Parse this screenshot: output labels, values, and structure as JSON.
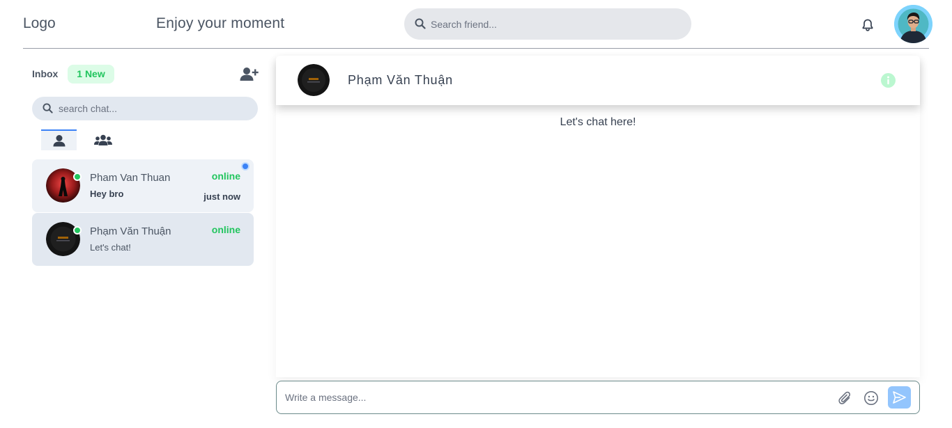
{
  "header": {
    "logo": "Logo",
    "tagline": "Enjoy your moment",
    "search_placeholder": "Search friend..."
  },
  "sidebar": {
    "inbox_label": "Inbox",
    "new_badge": "1 New",
    "search_placeholder": "search chat...",
    "conversations": [
      {
        "name": "Pham Van Thuan",
        "last_message": "Hey bro",
        "status": "online",
        "time": "just now",
        "unread": true
      },
      {
        "name": "Phạm Văn Thuận",
        "last_message": "Let's chat!",
        "status": "online",
        "time": "",
        "unread": false
      }
    ]
  },
  "chat": {
    "title": "Phạm Văn Thuận",
    "hint": "Let's chat here!",
    "composer_placeholder": "Write a message..."
  },
  "colors": {
    "accent": "#3b82f6",
    "online": "#22c55e",
    "new_badge_bg": "#dcfce7",
    "send_button": "#93c5fd"
  }
}
